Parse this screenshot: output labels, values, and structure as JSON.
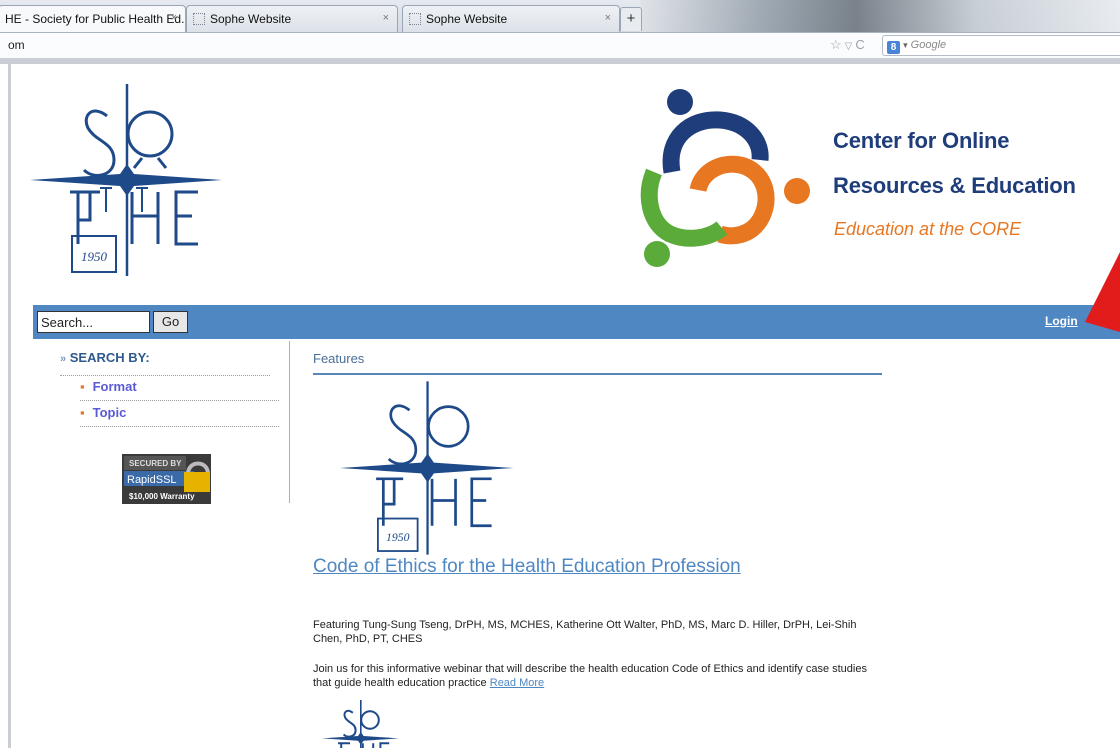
{
  "browser": {
    "tabs": [
      {
        "title": "HE - Society for Public Health Ed...",
        "active": true
      },
      {
        "title": "Sophe Website",
        "active": false
      },
      {
        "title": "Sophe Website",
        "active": false
      }
    ],
    "new_tab_label": "+",
    "tab_close_label": "×",
    "url": "om",
    "search_placeholder": "Google",
    "icons": [
      "star-icon",
      "dropdown-icon",
      "reload-icon",
      "google-icon"
    ]
  },
  "header": {
    "sophe_logo_year": "1950",
    "core": {
      "line1": "Center for Online",
      "line2": "Resources & Education",
      "tagline_prefix": "Education at the ",
      "tagline_em": "CORE"
    }
  },
  "nav": {
    "search_value": "Search...",
    "go_label": "Go",
    "login_label": "Login"
  },
  "sidebar": {
    "heading_prefix": "»",
    "heading": "SEARCH BY:",
    "items": [
      {
        "label": "Format"
      },
      {
        "label": "Topic"
      }
    ],
    "ssl_badge": {
      "line1": "SECURED BY",
      "line2": "RapidSSL",
      "line3": "$10,000 Warranty"
    }
  },
  "main": {
    "section_title": "Features",
    "article": {
      "logo_year": "1950",
      "title": "Code of Ethics for the Health Education Profession",
      "featuring": "Featuring Tung-Sung Tseng, DrPH, MS, MCHES, Katherine Ott Walter, PhD, MS, Marc D. Hiller, DrPH, Lei-Shih Chen, PhD, PT, CHES",
      "description": "Join us for this informative webinar that will describe the health education Code of Ethics and identify case studies that guide health education practice ",
      "read_more": "Read More"
    }
  },
  "colors": {
    "nav_blue": "#4f87c3",
    "core_navy": "#1f3d7a",
    "core_orange": "#e87722",
    "core_green": "#5aab3a",
    "annotation_red": "#e21b1b"
  }
}
